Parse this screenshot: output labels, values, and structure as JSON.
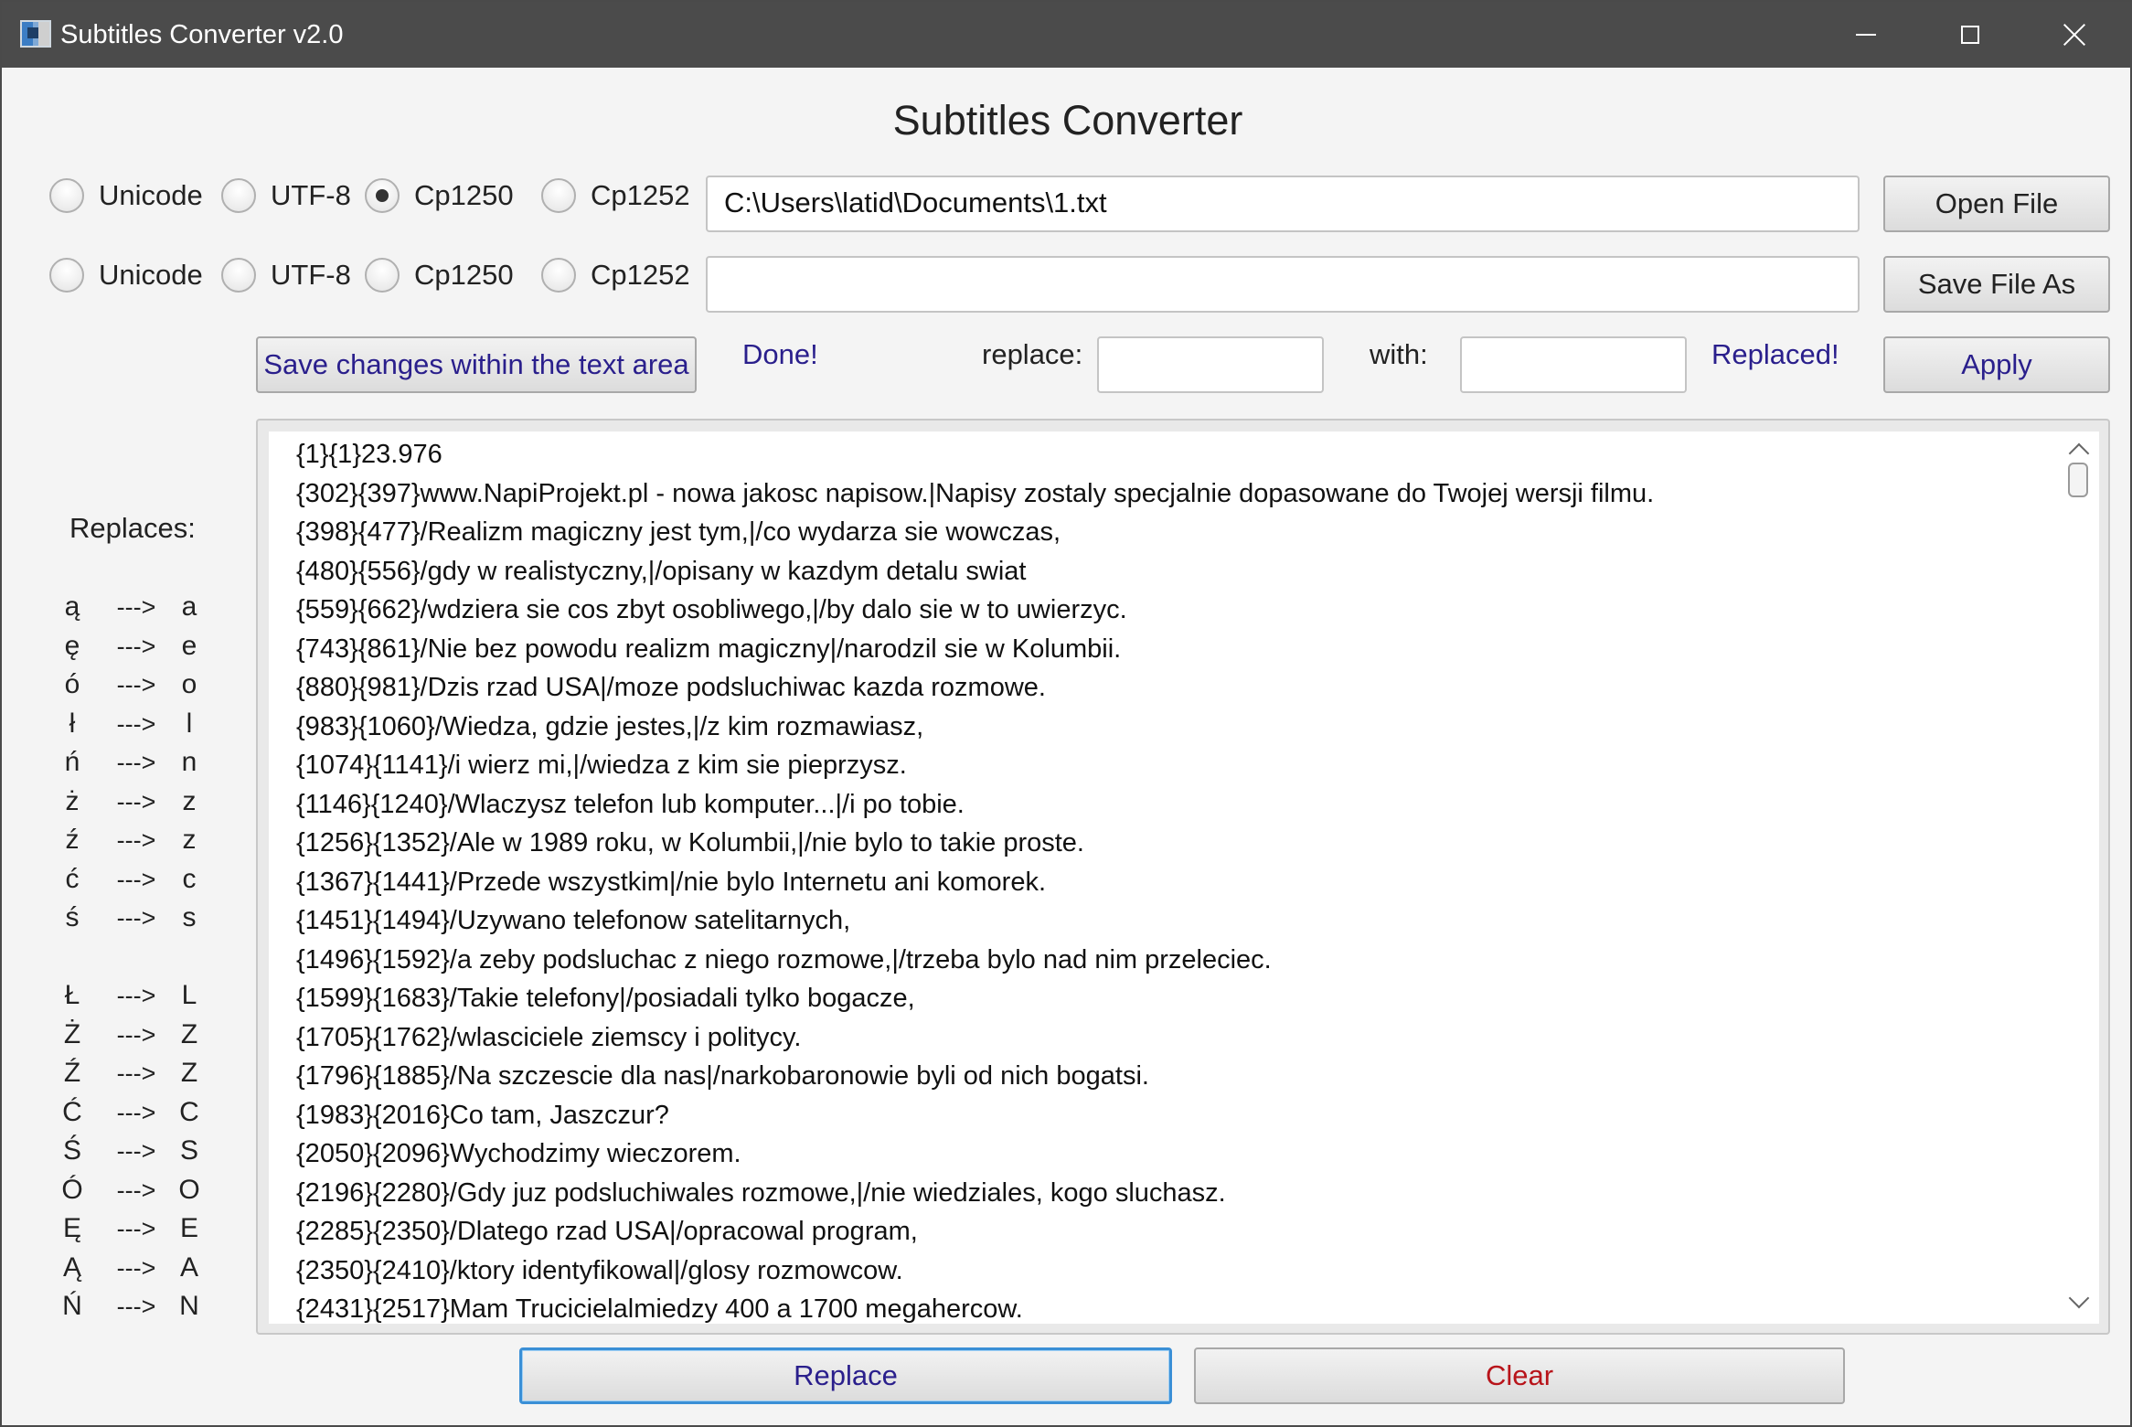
{
  "window": {
    "title": "Subtitles Converter v2.0"
  },
  "heading": "Subtitles Converter",
  "input_row": {
    "encodings": [
      {
        "label": "Unicode",
        "checked": false
      },
      {
        "label": "UTF-8",
        "checked": false
      },
      {
        "label": "Cp1250",
        "checked": true
      },
      {
        "label": "Cp1252",
        "checked": false
      }
    ],
    "path": "C:\\Users\\latid\\Documents\\1.txt",
    "button_label": "Open File"
  },
  "output_row": {
    "encodings": [
      {
        "label": "Unicode",
        "checked": false
      },
      {
        "label": "UTF-8",
        "checked": false
      },
      {
        "label": "Cp1250",
        "checked": false
      },
      {
        "label": "Cp1252",
        "checked": false
      }
    ],
    "path": "",
    "button_label": "Save File As"
  },
  "actions": {
    "save_changes_label": "Save changes within the text area",
    "done_status": "Done!",
    "replace_label": "replace:",
    "replace_value": "",
    "with_label": "with:",
    "with_value": "",
    "replaced_status": "Replaced!",
    "apply_label": "Apply"
  },
  "replaces": {
    "title": "Replaces:",
    "arrow": "--->",
    "lowercase": [
      {
        "from": "ą",
        "to": "a"
      },
      {
        "from": "ę",
        "to": "e"
      },
      {
        "from": "ó",
        "to": "o"
      },
      {
        "from": "ł",
        "to": "l"
      },
      {
        "from": "ń",
        "to": "n"
      },
      {
        "from": "ż",
        "to": "z"
      },
      {
        "from": "ź",
        "to": "z"
      },
      {
        "from": "ć",
        "to": "c"
      },
      {
        "from": "ś",
        "to": "s"
      }
    ],
    "uppercase": [
      {
        "from": "Ł",
        "to": "L"
      },
      {
        "from": "Ż",
        "to": "Z"
      },
      {
        "from": "Ź",
        "to": "Z"
      },
      {
        "from": "Ć",
        "to": "C"
      },
      {
        "from": "Ś",
        "to": "S"
      },
      {
        "from": "Ó",
        "to": "O"
      },
      {
        "from": "Ę",
        "to": "E"
      },
      {
        "from": "Ą",
        "to": "A"
      },
      {
        "from": "Ń",
        "to": "N"
      }
    ]
  },
  "text_area": {
    "lines": [
      "{1}{1}23.976",
      "{302}{397}www.NapiProjekt.pl - nowa jakosc napisow.|Napisy zostaly specjalnie dopasowane do Twojej wersji filmu.",
      "{398}{477}/Realizm magiczny jest tym,|/co wydarza sie wowczas,",
      "{480}{556}/gdy w realistyczny,|/opisany w kazdym detalu swiat",
      "{559}{662}/wdziera sie cos zbyt osobliwego,|/by dalo sie w to uwierzyc.",
      "{743}{861}/Nie bez powodu realizm magiczny|/narodzil sie w Kolumbii.",
      "{880}{981}/Dzis rzad USA|/moze podsluchiwac kazda rozmowe.",
      "{983}{1060}/Wiedza, gdzie jestes,|/z kim rozmawiasz,",
      "{1074}{1141}/i wierz mi,|/wiedza z kim sie pieprzysz.",
      "{1146}{1240}/Wlaczysz telefon lub komputer...|/i po tobie.",
      "{1256}{1352}/Ale w 1989 roku, w Kolumbii,|/nie bylo to takie proste.",
      "{1367}{1441}/Przede wszystkim|/nie bylo Internetu ani komorek.",
      "{1451}{1494}/Uzywano telefonow satelitarnych,",
      "{1496}{1592}/a zeby podsluchac z niego rozmowe,|/trzeba bylo nad nim przeleciec.",
      "{1599}{1683}/Takie telefony|/posiadali tylko bogacze,",
      "{1705}{1762}/wlasciciele ziemscy i politycy.",
      "{1796}{1885}/Na szczescie dla nas|/narkobaronowie byli od nich bogatsi.",
      "{1983}{2016}Co tam, Jaszczur?",
      "{2050}{2096}Wychodzimy wieczorem.",
      "{2196}{2280}/Gdy juz podsluchiwales rozmowe,|/nie wiedziales, kogo sluchasz.",
      "{2285}{2350}/Dlatego rzad USA|/opracowal program,",
      "{2350}{2410}/ktory identyfikowal|/glosy rozmowcow.",
      "{2431}{2517}Mam Trucicielalmiedzy 400 a 1700 megahercow."
    ]
  },
  "bottom": {
    "replace_label": "Replace",
    "clear_label": "Clear"
  },
  "colors": {
    "titlebar": "#4b4b4b",
    "status_text": "#2a1f8c",
    "clear_text": "#b8141a",
    "focus_border": "#3a8fd6"
  }
}
